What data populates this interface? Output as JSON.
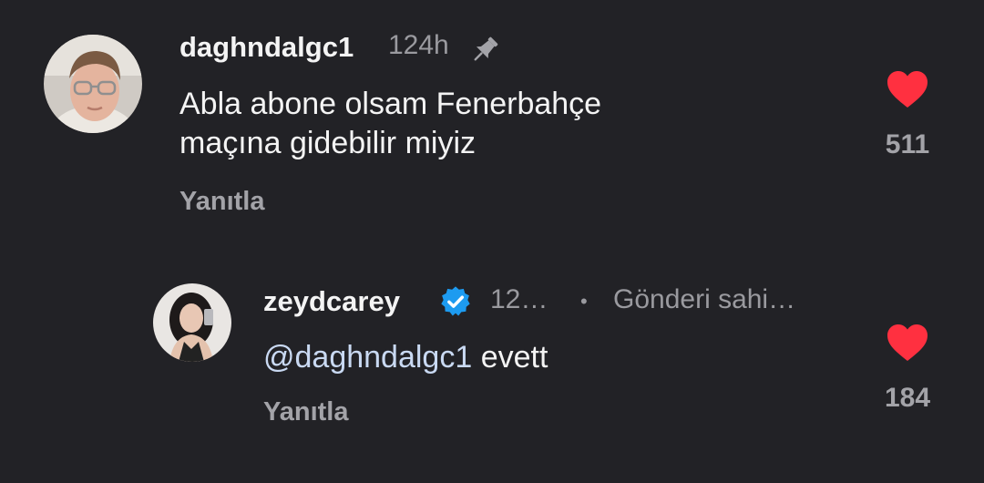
{
  "comment": {
    "username": "daghndalgc1",
    "time": "124h",
    "text_line1": "Abla abone olsam Fenerbahçe",
    "text_line2": "maçına gidebilir miyiz",
    "reply_label": "Yanıtla",
    "likes": "511"
  },
  "reply": {
    "username": "zeydcarey",
    "time": "12…",
    "separator": "•",
    "author_badge": "Gönderi sahi…",
    "mention": "@daghndalgc1",
    "text": " evett",
    "reply_label": "Yanıtla",
    "likes": "184"
  },
  "colors": {
    "background": "#222226",
    "heart": "#ff3040",
    "verified": "#1d9bf0",
    "mention": "#c9d9f2"
  },
  "icons": {
    "pin": "pin-icon",
    "heart": "heart-icon",
    "verified": "verified-badge-icon"
  }
}
